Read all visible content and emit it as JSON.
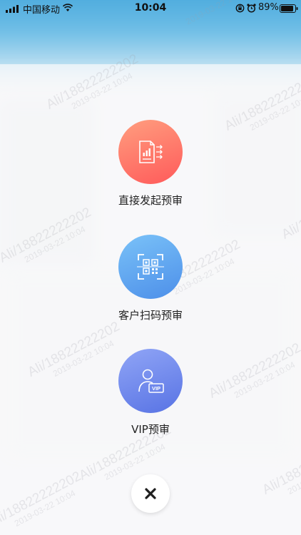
{
  "status_bar": {
    "carrier": "中国移动",
    "time": "10:04",
    "battery": "89%",
    "icons": [
      "signal-icon",
      "wifi-icon",
      "rotation-lock-icon",
      "alarm-icon",
      "battery-icon"
    ]
  },
  "watermark": {
    "id": "Ali/18822222202",
    "date": "2019-03-22 10:04"
  },
  "actions": [
    {
      "label": "直接发起预审",
      "icon": "document-send-icon",
      "color": "#ff7466"
    },
    {
      "label": "客户扫码预审",
      "icon": "qr-scan-icon",
      "color": "#5fa8f2"
    },
    {
      "label": "VIP预审",
      "icon": "vip-user-icon",
      "color": "#6e87ec"
    }
  ],
  "close": {
    "icon": "close-icon"
  }
}
